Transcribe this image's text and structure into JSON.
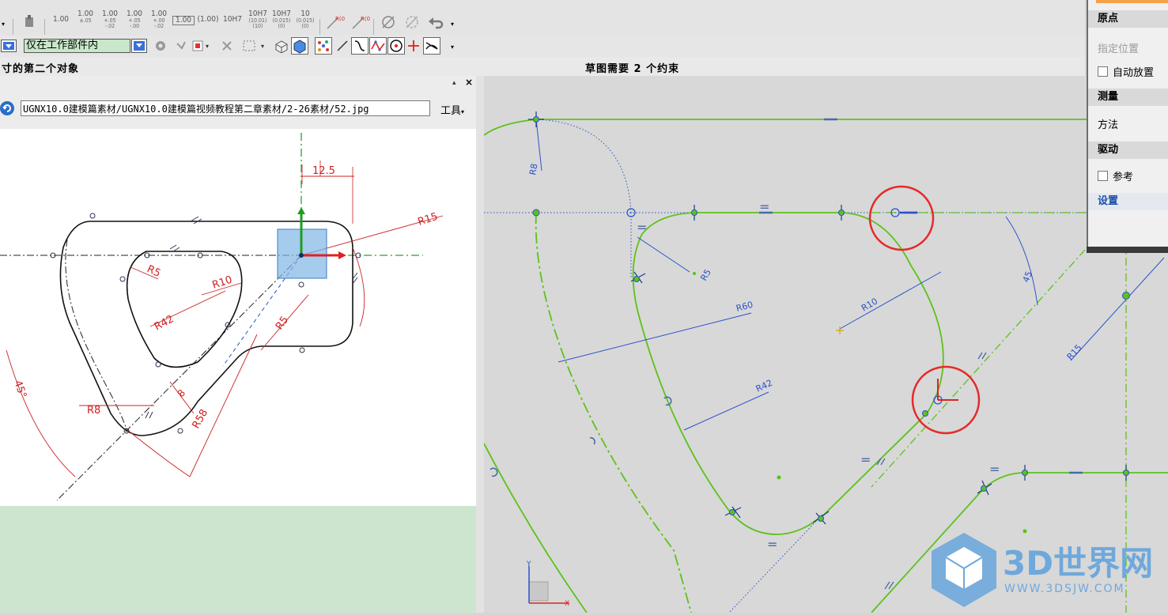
{
  "toolbar": {
    "tol_labels": [
      {
        "main": "1.00",
        "sub": ""
      },
      {
        "main": "1.00",
        "sub": "±.05"
      },
      {
        "main": "1.00",
        "sub": "+.05 -.02"
      },
      {
        "main": "1.00",
        "sub": "+.05 -.00"
      },
      {
        "main": "1.00",
        "sub": "+.00 -.02"
      },
      {
        "main": "1.00",
        "sub": ""
      },
      {
        "main": "(1.00)",
        "sub": ""
      },
      {
        "main": "10H7",
        "sub": ""
      },
      {
        "main": "10H7",
        "sub": "(10.01) (10)"
      },
      {
        "main": "10H7",
        "sub": "(0.015) (0)"
      },
      {
        "main": "10",
        "sub": "(0.015) (0)"
      }
    ],
    "filter_value": "仅在工作部件内"
  },
  "status": {
    "left": "寸的第二个对象",
    "right": "草图需要  2  个约束"
  },
  "viewer": {
    "path": "UGNX10.0建模篇素材/UGNX10.0建模篇视频教程第二章素材/2-26素材/52.jpg",
    "tools_label": "工具"
  },
  "drawing_labels": {
    "dim_top": "12.5",
    "r15": "R15",
    "r5a": "R5",
    "r10": "R10",
    "r42": "R42",
    "r5b": "R5",
    "r8": "R8",
    "r58": "R58",
    "ang45": "45°",
    "eight": "8"
  },
  "sketch_labels": {
    "r8": "R8",
    "r5": "R5",
    "r60": "R60",
    "r10": "R10",
    "r42": "R42",
    "r15": "R15",
    "ang": "45"
  },
  "panel": {
    "origin_header": "原点",
    "specify_location": "指定位置",
    "auto_place": "自动放置",
    "measure_header": "测量",
    "method": "方法",
    "drive_header": "驱动",
    "reference": "参考",
    "settings_header": "设置"
  },
  "watermark": {
    "brand": "3D世界网",
    "url": "WWW.3DSJW.COM"
  },
  "colors": {
    "sketch_green": "#5cc21a",
    "dim_blue": "#2a52c8",
    "marker_red": "#e52a2a",
    "viewer_green": "#cde5cf"
  }
}
